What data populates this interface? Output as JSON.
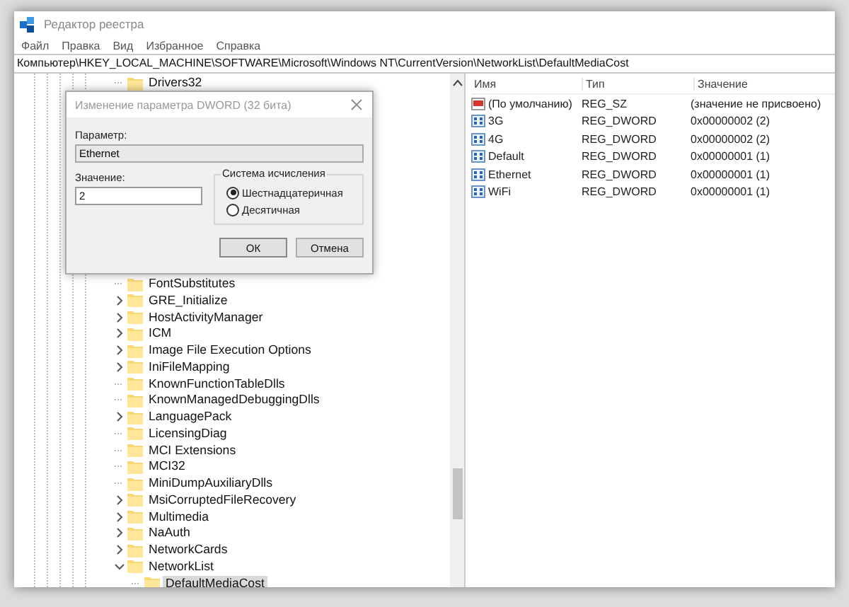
{
  "window": {
    "title": "Редактор реестра"
  },
  "menu": [
    "Файл",
    "Правка",
    "Вид",
    "Избранное",
    "Справка"
  ],
  "address": "Компьютер\\HKEY_LOCAL_MACHINE\\SOFTWARE\\Microsoft\\Windows NT\\CurrentVersion\\NetworkList\\DefaultMediaCost",
  "tree": {
    "items_above": [
      {
        "label": "Drivers32",
        "expandable": false,
        "selected": false
      }
    ],
    "items": [
      {
        "label": "FontSubstitutes",
        "expandable": false,
        "selected": false
      },
      {
        "label": "GRE_Initialize",
        "expandable": true,
        "expanded": false,
        "selected": false
      },
      {
        "label": "HostActivityManager",
        "expandable": true,
        "expanded": false,
        "selected": false
      },
      {
        "label": "ICM",
        "expandable": true,
        "expanded": false,
        "selected": false
      },
      {
        "label": "Image File Execution Options",
        "expandable": true,
        "expanded": false,
        "selected": false
      },
      {
        "label": "IniFileMapping",
        "expandable": true,
        "expanded": false,
        "selected": false
      },
      {
        "label": "KnownFunctionTableDlls",
        "expandable": false,
        "selected": false
      },
      {
        "label": "KnownManagedDebuggingDlls",
        "expandable": false,
        "selected": false
      },
      {
        "label": "LanguagePack",
        "expandable": true,
        "expanded": false,
        "selected": false
      },
      {
        "label": "LicensingDiag",
        "expandable": false,
        "selected": false
      },
      {
        "label": "MCI Extensions",
        "expandable": false,
        "selected": false
      },
      {
        "label": "MCI32",
        "expandable": false,
        "selected": false
      },
      {
        "label": "MiniDumpAuxiliaryDlls",
        "expandable": false,
        "selected": false
      },
      {
        "label": "MsiCorruptedFileRecovery",
        "expandable": true,
        "expanded": false,
        "selected": false
      },
      {
        "label": "Multimedia",
        "expandable": true,
        "expanded": false,
        "selected": false
      },
      {
        "label": "NaAuth",
        "expandable": true,
        "expanded": false,
        "selected": false
      },
      {
        "label": "NetworkCards",
        "expandable": true,
        "expanded": false,
        "selected": false
      },
      {
        "label": "NetworkList",
        "expandable": true,
        "expanded": true,
        "selected": false,
        "children": [
          {
            "label": "DefaultMediaCost",
            "expandable": false,
            "selected": true
          }
        ]
      }
    ]
  },
  "values": {
    "columns": [
      "Имя",
      "Тип",
      "Значение"
    ],
    "rows": [
      {
        "kind": "string",
        "name": "(По умолчанию)",
        "type": "REG_SZ",
        "value": "(значение не присвоено)"
      },
      {
        "kind": "dword",
        "name": "3G",
        "type": "REG_DWORD",
        "value": "0x00000002 (2)"
      },
      {
        "kind": "dword",
        "name": "4G",
        "type": "REG_DWORD",
        "value": "0x00000002 (2)"
      },
      {
        "kind": "dword",
        "name": "Default",
        "type": "REG_DWORD",
        "value": "0x00000001 (1)"
      },
      {
        "kind": "dword",
        "name": "Ethernet",
        "type": "REG_DWORD",
        "value": "0x00000001 (1)"
      },
      {
        "kind": "dword",
        "name": "WiFi",
        "type": "REG_DWORD",
        "value": "0x00000001 (1)"
      }
    ]
  },
  "dialog": {
    "title": "Изменение параметра DWORD (32 бита)",
    "name_label": "Параметр:",
    "name_value": "Ethernet",
    "value_label": "Значение:",
    "value": "2",
    "base_group": "Система исчисления",
    "bases": [
      {
        "label": "Шестнадцатеричная",
        "selected": true
      },
      {
        "label": "Десятичная",
        "selected": false
      }
    ],
    "buttons": [
      "ОК",
      "Отмена"
    ]
  }
}
